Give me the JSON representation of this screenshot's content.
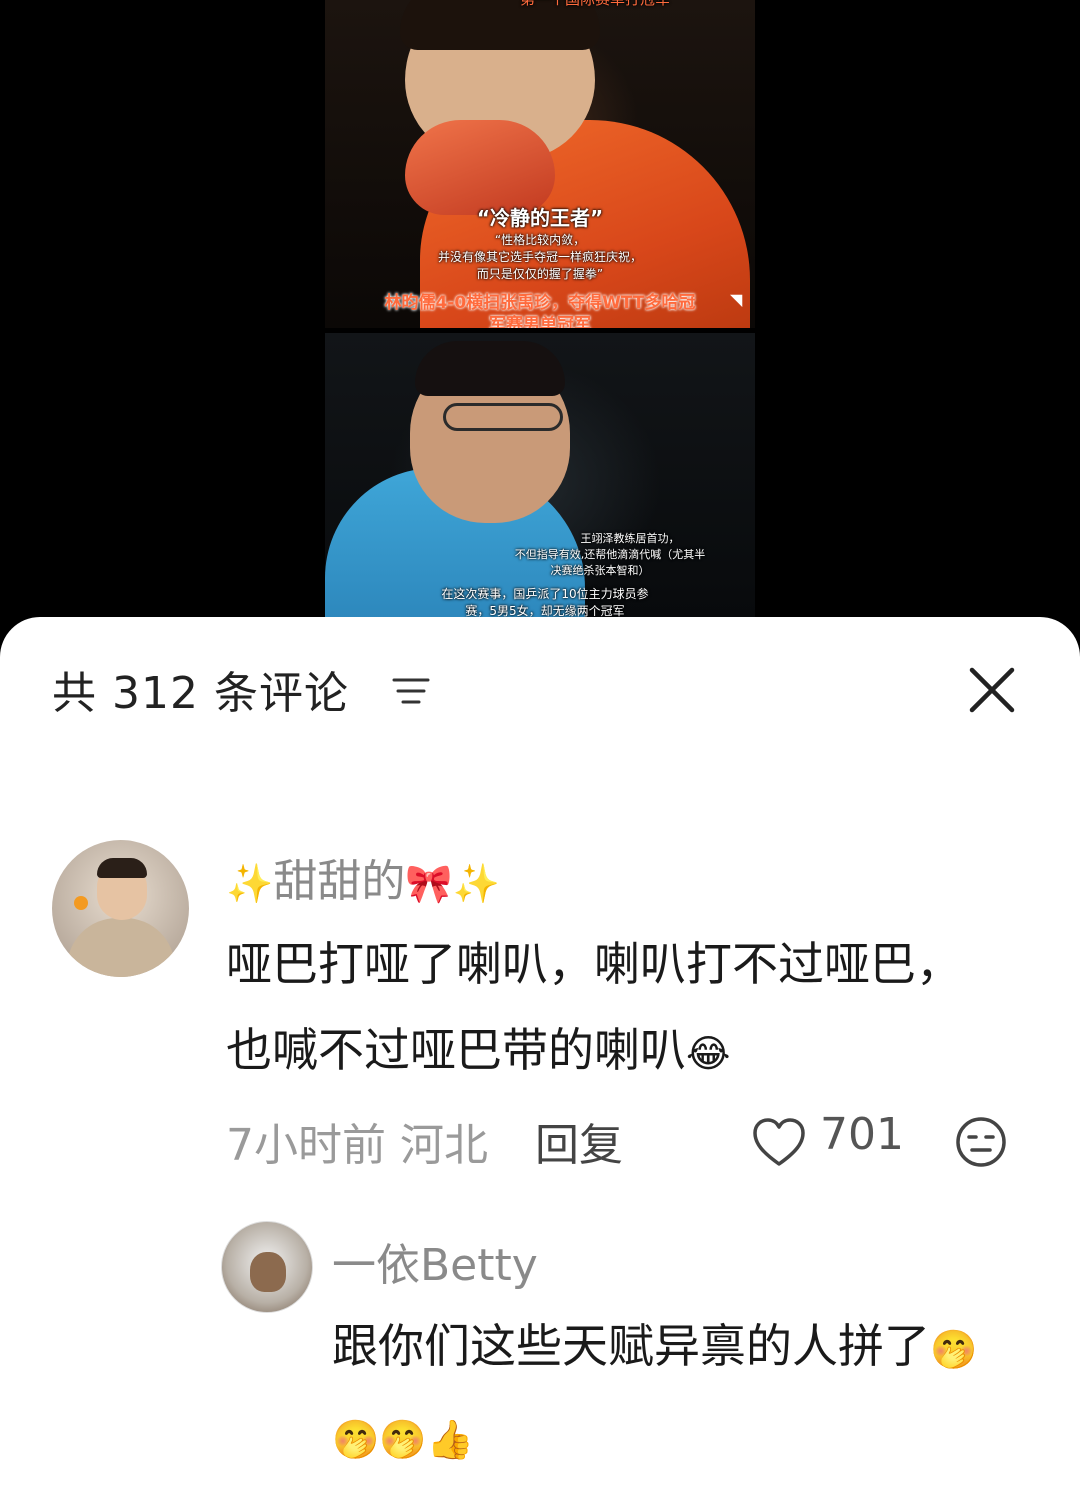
{
  "video": {
    "caption_top": "第一个国际赛单打冠军",
    "caption_title": "“冷静的王者”",
    "caption_quote_lines": [
      "“性格比较内敛，",
      "并没有像其它选手夺冠一样疯狂庆祝，",
      "而只是仅仅的握了握拳”"
    ],
    "caption_headline_lines": [
      "林昀儒4-0横扫张禹珍，夺得WTT多哈冠",
      "军赛男单冠军"
    ],
    "caption_coach_lines": [
      "王翊泽教练居首功，",
      "不但指导有效,还帮他滴滴代喊（尤其半",
      "决赛绝杀张本智和）"
    ],
    "caption_bottom_lines": [
      "在这次赛事，国乒派了10位主力球员参",
      "赛，5男5女，却无缘两个冠军"
    ]
  },
  "comments_header": {
    "title": "共 312 条评论",
    "sort_icon": "sort-lines-icon",
    "close_icon": "close-icon"
  },
  "comments": [
    {
      "username_prefix": "✨",
      "username_text": "甜甜的",
      "username_suffix": "🎀✨",
      "content": "哑巴打哑了喇叭，喇叭打不过哑巴，也喊不过哑巴带的喇叭",
      "content_emoji": "😂",
      "time": "7小时前",
      "location": "河北",
      "reply_label": "回复",
      "likes": "701"
    },
    {
      "username": "一依Betty",
      "content": "跟你们这些天赋异禀的人拼了",
      "content_emoji": "🤭🤭🤭👍"
    }
  ],
  "colors": {
    "sheet_bg": "#ffffff",
    "text_primary": "#1a1a1a",
    "text_secondary": "#9a9a9a",
    "caption_red": "#ff6a3c"
  }
}
